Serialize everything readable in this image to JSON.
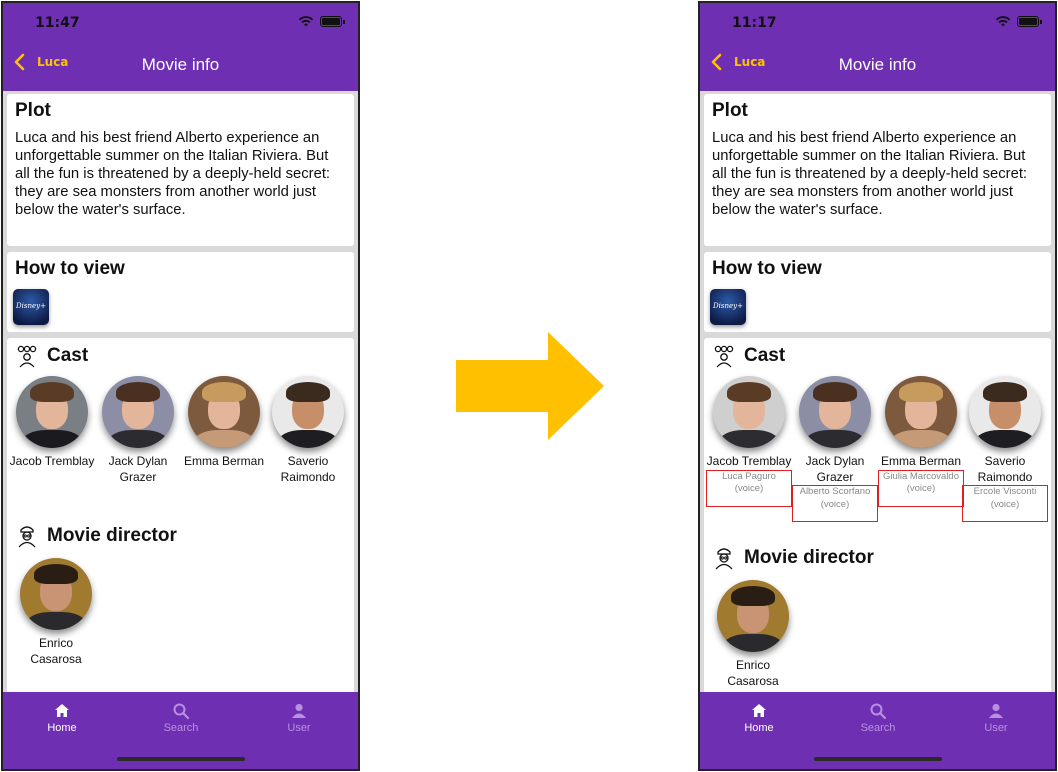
{
  "colors": {
    "header": "#6f2fb3",
    "accent": "#ffc107",
    "arrow": "#ffc000",
    "highlight_border": "#e02020"
  },
  "left": {
    "status_time": "11:47",
    "back_label": "Luca",
    "title": "Movie info",
    "plot": {
      "heading": "Plot",
      "text": "Luca and his best friend Alberto experience an unforgettable summer on the Italian Riviera. But all the fun is threatened by a deeply-held secret: they are sea monsters from another world just below the water's surface."
    },
    "how_to_view": {
      "heading": "How to view",
      "service": "Disney+"
    },
    "cast": {
      "heading": "Cast",
      "members": [
        {
          "name": "Jacob Tremblay"
        },
        {
          "name": "Jack Dylan Grazer"
        },
        {
          "name": "Emma Berman"
        },
        {
          "name": "Saverio Raimondo"
        }
      ]
    },
    "director": {
      "heading": "Movie director",
      "name": "Enrico Casarosa"
    },
    "tabs": [
      {
        "label": "Home",
        "icon": "home-icon",
        "active": true
      },
      {
        "label": "Search",
        "icon": "search-icon",
        "active": false
      },
      {
        "label": "User",
        "icon": "user-icon",
        "active": false
      }
    ]
  },
  "right": {
    "status_time": "11:17",
    "back_label": "Luca",
    "title": "Movie info",
    "plot": {
      "heading": "Plot",
      "text": "Luca and his best friend Alberto experience an unforgettable summer on the Italian Riviera. But all the fun is threatened by a deeply-held secret: they are sea monsters from another world just below the water's surface."
    },
    "how_to_view": {
      "heading": "How to view",
      "service": "Disney+"
    },
    "cast": {
      "heading": "Cast",
      "members": [
        {
          "name": "Jacob Tremblay",
          "role": "Luca Paguro (voice)"
        },
        {
          "name": "Jack Dylan Grazer",
          "role": "Alberto Scorfano (voice)"
        },
        {
          "name": "Emma Berman",
          "role": "Giulia Marcovaldo (voice)"
        },
        {
          "name": "Saverio Raimondo",
          "role": "Ercole Visconti (voice)"
        }
      ]
    },
    "director": {
      "heading": "Movie director",
      "name": "Enrico Casarosa"
    },
    "tabs": [
      {
        "label": "Home",
        "icon": "home-icon",
        "active": true
      },
      {
        "label": "Search",
        "icon": "search-icon",
        "active": false
      },
      {
        "label": "User",
        "icon": "user-icon",
        "active": false
      }
    ]
  }
}
